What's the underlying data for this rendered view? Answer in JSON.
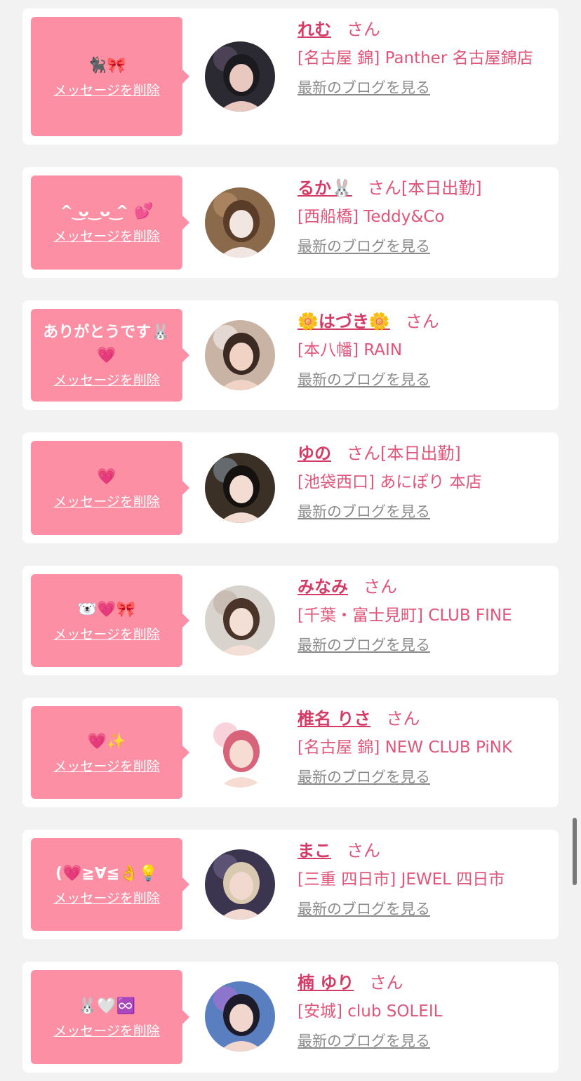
{
  "colors": {
    "background": "#f2f2f2",
    "card": "#ffffff",
    "bubble": "#fd8fa5",
    "name": "#d43b66",
    "text_pink": "#e0557a",
    "link_gray": "#8a8a8a"
  },
  "delete_label": "メッセージを削除",
  "blog_label": "最新のブログを見る",
  "items": [
    {
      "message": "🐈‍⬛🎀",
      "name": "れむ",
      "suffix": "さん",
      "shop": "[名古屋 錦] Panther 名古屋錦店",
      "avatar_icon": "photo-dark-hair-girl"
    },
    {
      "message": "^ ͜ᴗ ͜ ᴗ ͜^ 💕",
      "name": "るか🐰",
      "suffix": "さん[本日出勤]",
      "shop": "[西船橋] Teddy&Co",
      "avatar_icon": "photo-blurred-face"
    },
    {
      "message": "ありがとうです🐰💗",
      "name": "🌼はづき🌼",
      "suffix": "さん",
      "shop": "[本八幡] RAIN",
      "avatar_icon": "photo-pearl-headband"
    },
    {
      "message": "💗",
      "name": "ゆの",
      "suffix": "さん[本日出勤]",
      "shop": "[池袋西口] あにぽり 本店",
      "avatar_icon": "photo-bangs-girl"
    },
    {
      "message": "🐻‍❄️💗🎀",
      "name": "みなみ",
      "suffix": "さん",
      "shop": "[千葉・富士見町] CLUB FINE",
      "avatar_icon": "photo-braid-girl"
    },
    {
      "message": "💗✨",
      "name": "椎名 りさ",
      "suffix": "さん",
      "shop": "[名古屋 錦] NEW CLUB PiNK",
      "avatar_icon": "photo-pink-hair-girl"
    },
    {
      "message": "(💗≧∀≦👌💡",
      "name": "まこ",
      "suffix": "さん",
      "shop": "[三重 四日市] JEWEL 四日市",
      "avatar_icon": "photo-blonde-girl"
    },
    {
      "message": "🐰🤍♾️",
      "name": "楠 ゆり",
      "suffix": "さん",
      "shop": "[安城] club SOLEIL",
      "avatar_icon": "photo-fantasy-background"
    }
  ]
}
